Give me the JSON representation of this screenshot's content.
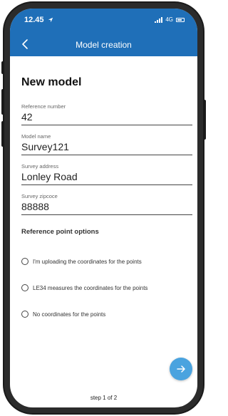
{
  "status_bar": {
    "time": "12.45",
    "network": "4G"
  },
  "header": {
    "title": "Model creation"
  },
  "page": {
    "heading": "New model"
  },
  "fields": {
    "reference_number": {
      "label": "Reference number",
      "value": "42"
    },
    "model_name": {
      "label": "Model name",
      "value": "Survey121"
    },
    "survey_address": {
      "label": "Survey address",
      "value": "Lonley Road"
    },
    "survey_zipcode": {
      "label": "Survey zipcoce",
      "value": "88888"
    }
  },
  "reference_options": {
    "title": "Reference point options",
    "options": [
      {
        "label": "I'm uploading the coordinates for the points",
        "selected": false
      },
      {
        "label": "LE34 measures the coordinates for the points",
        "selected": false
      },
      {
        "label": "No coordinates for the points",
        "selected": false
      }
    ]
  },
  "footer": {
    "step": "step 1 of 2"
  },
  "colors": {
    "header": "#1f6fb8",
    "fab": "#4aa3df"
  },
  "icons": {
    "back": "chevron-left-icon",
    "next": "arrow-right-icon",
    "location": "location-arrow-icon"
  }
}
